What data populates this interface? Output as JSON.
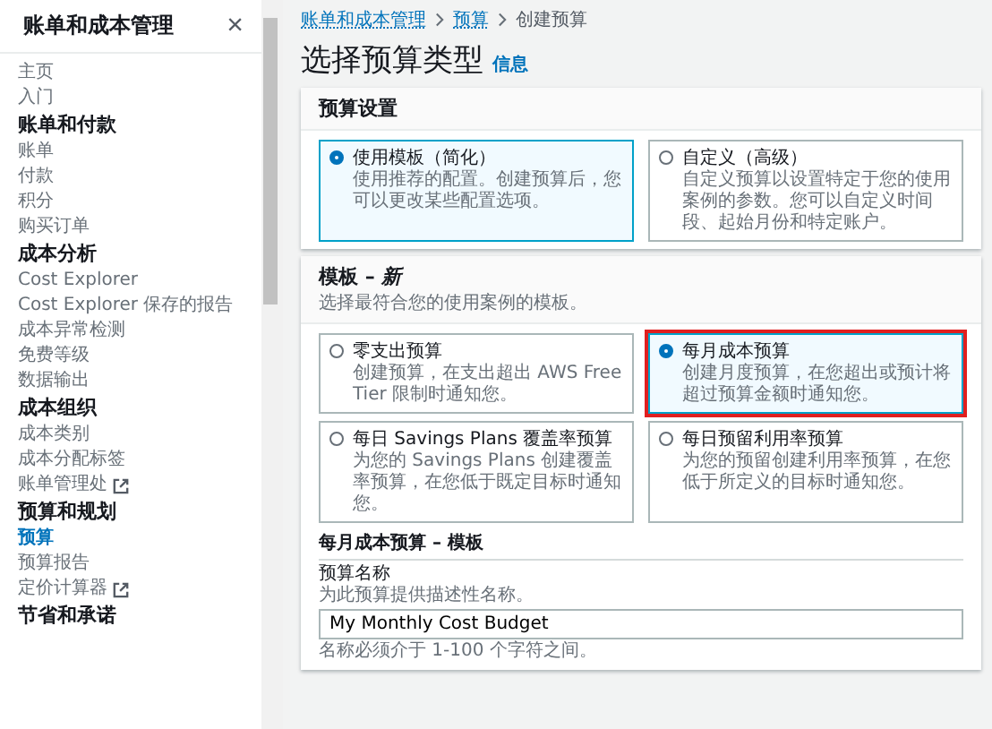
{
  "sidebar": {
    "title": "账单和成本管理",
    "close": "×",
    "sections": [
      {
        "items": [
          {
            "label": "主页",
            "selected": false,
            "external": false
          },
          {
            "label": "入门",
            "selected": false,
            "external": false
          }
        ]
      },
      {
        "heading": "账单和付款",
        "items": [
          {
            "label": "账单",
            "selected": false,
            "external": false
          },
          {
            "label": "付款",
            "selected": false,
            "external": false
          },
          {
            "label": "积分",
            "selected": false,
            "external": false
          },
          {
            "label": "购买订单",
            "selected": false,
            "external": false
          }
        ]
      },
      {
        "heading": "成本分析",
        "items": [
          {
            "label": "Cost Explorer",
            "selected": false,
            "external": false
          },
          {
            "label": "Cost Explorer 保存的报告",
            "selected": false,
            "external": false
          },
          {
            "label": "成本异常检测",
            "selected": false,
            "external": false
          },
          {
            "label": "免费等级",
            "selected": false,
            "external": false
          },
          {
            "label": "数据输出",
            "selected": false,
            "external": false
          }
        ]
      },
      {
        "heading": "成本组织",
        "items": [
          {
            "label": "成本类别",
            "selected": false,
            "external": false
          },
          {
            "label": "成本分配标签",
            "selected": false,
            "external": false
          },
          {
            "label": "账单管理处",
            "selected": false,
            "external": true
          }
        ]
      },
      {
        "heading": "预算和规划",
        "items": [
          {
            "label": "预算",
            "selected": true,
            "external": false
          },
          {
            "label": "预算报告",
            "selected": false,
            "external": false
          },
          {
            "label": "定价计算器",
            "selected": false,
            "external": true
          }
        ]
      },
      {
        "heading": "节省和承诺"
      }
    ]
  },
  "breadcrumbs": [
    {
      "label": "账单和成本管理",
      "link": true
    },
    {
      "label": "预算",
      "link": true
    },
    {
      "label": "创建预算",
      "link": false
    }
  ],
  "page_title": "选择预算类型",
  "info_link": "信息",
  "setup_card": {
    "title": "预算设置",
    "options": [
      {
        "label": "使用模板（简化）",
        "description": "使用推荐的配置。创建预算后，您可以更改某些配置选项。",
        "selected": true,
        "highlighted": false
      },
      {
        "label": "自定义（高级）",
        "description": "自定义预算以设置特定于您的使用案例的参数。您可以自定义时间段、起始月份和特定账户。",
        "selected": false,
        "highlighted": false
      }
    ]
  },
  "template_card": {
    "title": "模板 – *新*",
    "subtitle": "选择最符合您的使用案例的模板。",
    "options": [
      {
        "label": "零支出预算",
        "description": "创建预算，在支出超出 AWS Free Tier 限制时通知您。",
        "selected": false,
        "highlighted": false
      },
      {
        "label": "每月成本预算",
        "description": "创建月度预算，在您超出或预计将超过预算金额时通知您。",
        "selected": true,
        "highlighted": true
      },
      {
        "label": "每日 Savings Plans 覆盖率预算",
        "description": "为您的 Savings Plans 创建覆盖率预算，在您低于既定目标时通知您。",
        "selected": false,
        "highlighted": false
      },
      {
        "label": "每日预留利用率预算",
        "description": "为您的预留创建利用率预算，在您低于所定义的目标时通知您。",
        "selected": false,
        "highlighted": false
      }
    ],
    "section_title": "每月成本预算 – 模板",
    "field": {
      "label": "预算名称",
      "hint": "为此预算提供描述性名称。",
      "value": "My Monthly Cost Budget",
      "help": "名称必须介于 1-100 个字符之间。"
    }
  }
}
